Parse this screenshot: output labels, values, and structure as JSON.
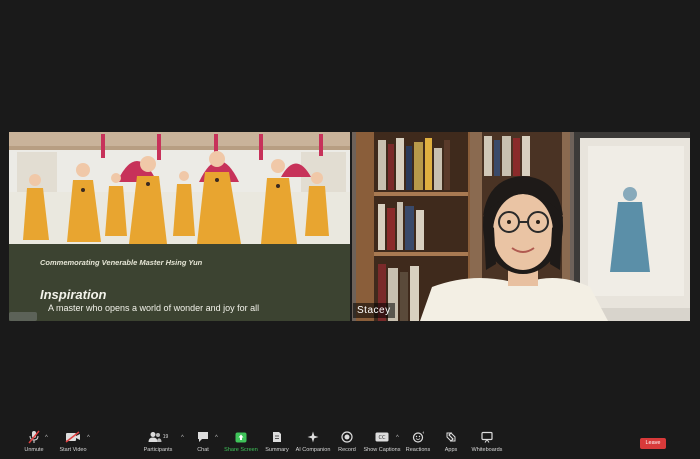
{
  "share": {
    "subtitle": "Commemorating Venerable Master Hsing Yun",
    "title": "Inspiration",
    "body": "A master who opens a world of wonder and joy for all"
  },
  "participant": {
    "name": "Stacey"
  },
  "toolbar": {
    "unmute": "Unmute",
    "start_video": "Start Video",
    "participants": "Participants",
    "participants_count": "19",
    "chat": "Chat",
    "share_screen": "Share Screen",
    "summary": "Summary",
    "ai_companion": "AI Companion",
    "record": "Record",
    "show_captions": "Show Captions",
    "reactions": "Reactions",
    "apps": "Apps",
    "whiteboards": "Whiteboards",
    "leave": "Leave"
  },
  "colors": {
    "share_screen_accent": "#3fc45a",
    "leave": "#d83a3a"
  }
}
